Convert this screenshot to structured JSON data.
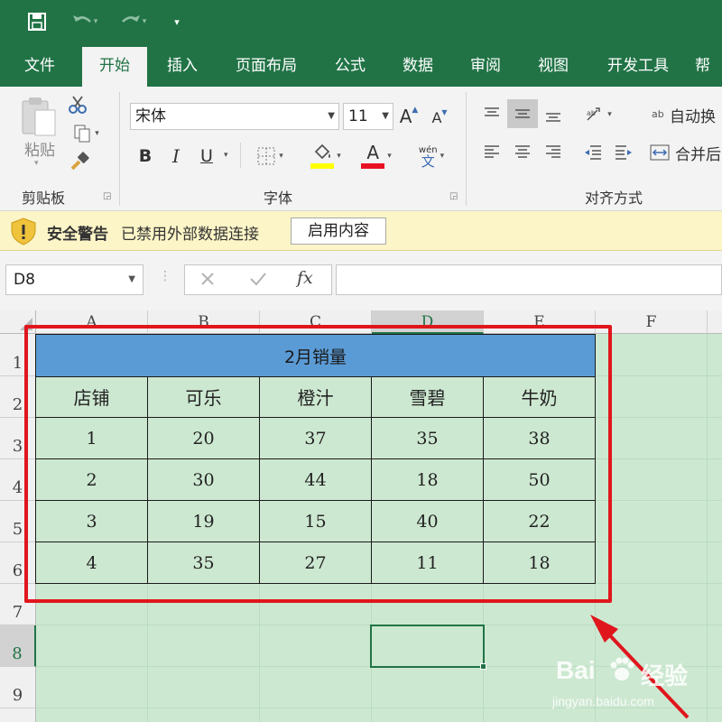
{
  "ribbon_tabs": [
    {
      "label": "文件",
      "active": false
    },
    {
      "label": "开始",
      "active": true
    },
    {
      "label": "插入",
      "active": false
    },
    {
      "label": "页面布局",
      "active": false
    },
    {
      "label": "公式",
      "active": false
    },
    {
      "label": "数据",
      "active": false
    },
    {
      "label": "审阅",
      "active": false
    },
    {
      "label": "视图",
      "active": false
    },
    {
      "label": "开发工具",
      "active": false
    },
    {
      "label": "帮",
      "active": false
    }
  ],
  "clipboard": {
    "paste_label": "粘贴",
    "group_label": "剪贴板"
  },
  "font": {
    "name": "宋体",
    "size": "11",
    "group_label": "字体",
    "bold": "B",
    "italic": "I",
    "underline": "U",
    "grow": "A",
    "shrink": "A",
    "fontcolor_glyph": "A",
    "phonetic_top": "wén",
    "phonetic_bottom": "文",
    "highlight_color": "#ffff00",
    "font_color": "#e81123"
  },
  "alignment": {
    "wrap_label": "自动换",
    "merge_label": "合并后",
    "group_label": "对齐方式",
    "wrap_prefix": "ab"
  },
  "security_bar": {
    "title": "安全警告",
    "message": "已禁用外部数据连接",
    "button": "启用内容"
  },
  "formula_bar": {
    "name_box": "D8",
    "fx": "fx",
    "value": ""
  },
  "sheet": {
    "columns": [
      "A",
      "B",
      "C",
      "D",
      "E",
      "F"
    ],
    "rows": [
      "1",
      "2",
      "3",
      "4",
      "5",
      "6",
      "7",
      "8",
      "9"
    ],
    "selected_cell": "D8",
    "table_title": "2月销量",
    "headers": [
      "店铺",
      "可乐",
      "橙汁",
      "雪碧",
      "牛奶"
    ],
    "data": [
      [
        "1",
        "20",
        "37",
        "35",
        "38"
      ],
      [
        "2",
        "30",
        "44",
        "18",
        "50"
      ],
      [
        "3",
        "19",
        "15",
        "40",
        "22"
      ],
      [
        "4",
        "35",
        "27",
        "11",
        "18"
      ]
    ],
    "colors": {
      "title_fill": "#5b9bd5",
      "body_fill": "#cde8d1",
      "highlight_box": "#e0161d",
      "accent": "#217346"
    }
  },
  "watermark": {
    "brand": "Bai",
    "brand_tail": "经验",
    "url": "jingyan.baidu.com"
  }
}
